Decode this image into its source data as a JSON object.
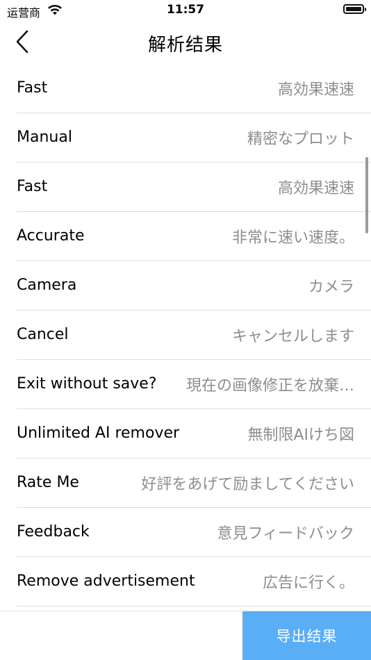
{
  "status_bar": {
    "carrier": "运营商",
    "time": "11:57"
  },
  "nav": {
    "title": "解析结果"
  },
  "rows": [
    {
      "label": "Fast",
      "value": "高効果速速"
    },
    {
      "label": "Manual",
      "value": "精密なプロット"
    },
    {
      "label": "Fast",
      "value": "高効果速速"
    },
    {
      "label": "Accurate",
      "value": "非常に速い速度。"
    },
    {
      "label": "Camera",
      "value": "カメラ"
    },
    {
      "label": "Cancel",
      "value": "キャンセルします"
    },
    {
      "label": "Exit without save?",
      "value": "現在の画像修正を放棄…"
    },
    {
      "label": "Unlimited AI remover",
      "value": "無制限AIけち図"
    },
    {
      "label": "Rate Me",
      "value": "好評をあげて励ましてください"
    },
    {
      "label": "Feedback",
      "value": "意見フィードバック"
    },
    {
      "label": "Remove advertisement",
      "value": "広告に行く。"
    }
  ],
  "export_button": {
    "label": "导出结果",
    "color": "#5aaef6"
  }
}
